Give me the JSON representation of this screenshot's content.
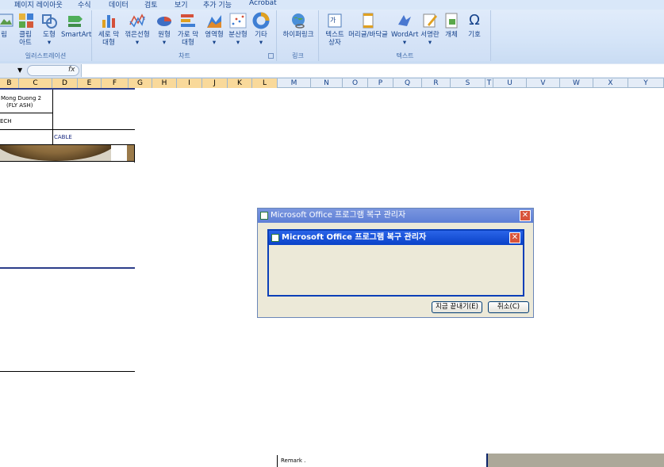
{
  "ribbon": {
    "tabs": [
      "페이지 레이아웃",
      "수식",
      "데이터",
      "검토",
      "보기",
      "추가 기능",
      "Acrobat"
    ],
    "illustrations": {
      "label": "일러스트레이션",
      "buttons": [
        "림",
        "클립 아트",
        "도형",
        "SmartArt"
      ]
    },
    "charts": {
      "label": "차트",
      "buttons": [
        "세로 막대형",
        "꺾은선형",
        "원형",
        "가로 막대형",
        "영역형",
        "분산형",
        "기타"
      ]
    },
    "links": {
      "label": "링크",
      "buttons": [
        "하이퍼링크"
      ]
    },
    "text": {
      "label": "텍스트",
      "buttons": [
        "텍스트 상자",
        "머리글/바닥글",
        "WordArt",
        "서명란",
        "개체",
        "기호"
      ]
    }
  },
  "formula_bar": {
    "fx": "fx"
  },
  "columns": [
    "B",
    "C",
    "D",
    "E",
    "F",
    "G",
    "H",
    "I",
    "J",
    "K",
    "L",
    "M",
    "N",
    "O",
    "P",
    "Q",
    "R",
    "S",
    "T",
    "U",
    "V",
    "W",
    "X",
    "Y"
  ],
  "sheet": {
    "cell_mong_duong": "Mong Duong 2",
    "cell_fly_ash": "(FLY ASH)",
    "cell_ech": "ECH",
    "cell_cable": "CABLE",
    "remark": "Remark ."
  },
  "dialog_back": {
    "title": "Microsoft Office 프로그램 복구 관리자"
  },
  "dialog_front": {
    "title": "Microsoft Office 프로그램 복구 관리자"
  },
  "dialog_buttons": {
    "end_now": "지금 끝내기(E)",
    "cancel": "취소(C)"
  }
}
